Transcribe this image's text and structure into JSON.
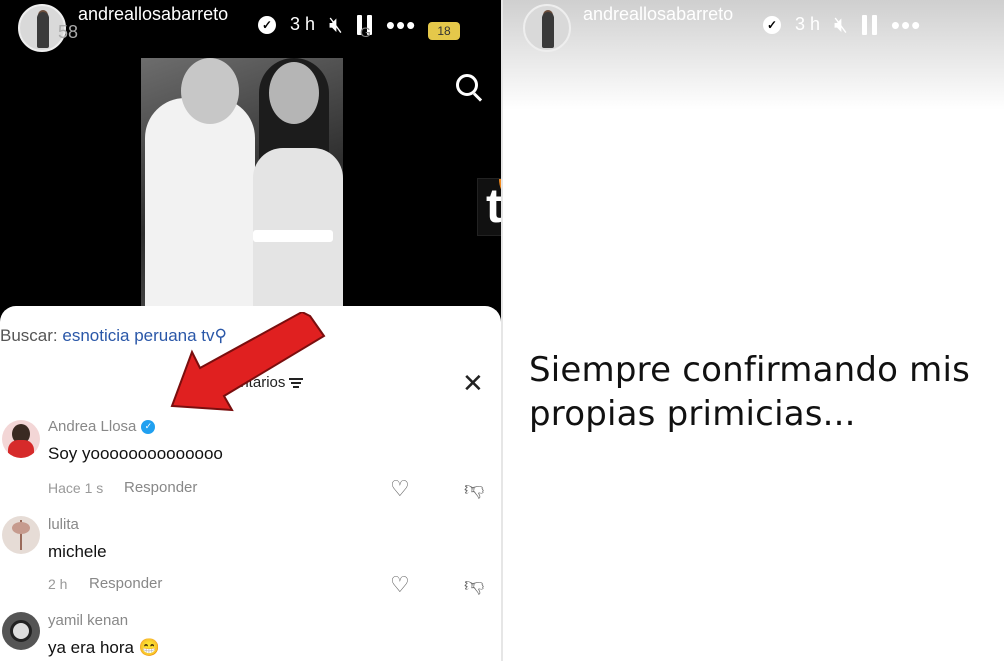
{
  "left_story": {
    "username": "andreallosabarreto",
    "time": "3 h",
    "status_ghost": "58",
    "status_right": "G",
    "badge": "18",
    "search_label": "Buscar:",
    "search_query": "esnoticia peruana tv",
    "comments_title": "entarios",
    "comments": [
      {
        "name": "Andrea Llosa",
        "verified": true,
        "text": "Soy yoooooooooooooo",
        "time": "Hace 1 s",
        "reply": "Responder"
      },
      {
        "name": "lulita",
        "verified": false,
        "text": "michele",
        "time": "2 h",
        "reply": "Responder"
      },
      {
        "name": "yamil kenan",
        "verified": false,
        "text": "ya era hora",
        "emoji": "😁"
      }
    ]
  },
  "right_story": {
    "username": "andreallosabarreto",
    "time": "3 h",
    "text_line1": "Siempre confirmando mis",
    "text_line2": "propias primicias..."
  },
  "icons": {
    "verified": "verified-icon",
    "mute": "mute-icon",
    "pause": "pause-icon",
    "more": "more-icon",
    "search": "search-icon",
    "close": "close-icon",
    "heart": "heart-icon",
    "dislike": "dislike-icon"
  },
  "colors": {
    "accent_link": "#2a57a8",
    "verified_blue": "#20a0f0",
    "arrow_red": "#e02020",
    "logo_orange": "#f38b1e"
  }
}
